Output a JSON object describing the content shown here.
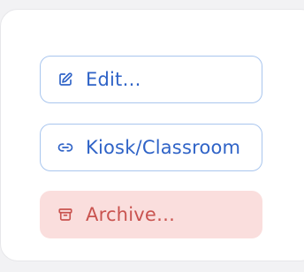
{
  "actions": {
    "edit": {
      "label": "Edit…",
      "icon": "edit-icon"
    },
    "kiosk": {
      "label": "Kiosk/Classroom",
      "icon": "link-icon"
    },
    "archive": {
      "label": "Archive…",
      "icon": "archive-icon"
    }
  },
  "colors": {
    "primary": "#2f63c7",
    "primary_border": "#a9c6ee",
    "danger": "#c9534f",
    "danger_bg": "#fadedd",
    "card_bg": "#ffffff",
    "page_bg": "#f2f2f4"
  }
}
